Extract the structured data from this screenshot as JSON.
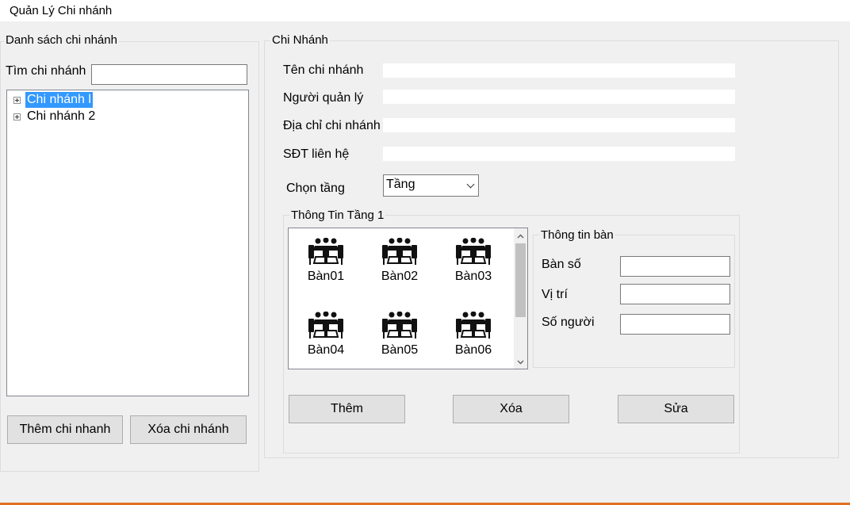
{
  "window": {
    "title": "Quản Lý Chi nhánh"
  },
  "left_panel": {
    "group_title": "Danh sách chi nhánh",
    "search_label": "Tìm chi nhánh",
    "search_value": "",
    "tree_items": [
      {
        "label": "Chi nhánh l",
        "selected": true
      },
      {
        "label": "Chi nhánh 2",
        "selected": false
      }
    ],
    "add_button": "Thêm chi nhanh",
    "delete_button": "Xóa chi nhánh"
  },
  "branch_panel": {
    "group_title": "Chi Nhánh",
    "name_label": "Tên chi nhánh",
    "manager_label": "Người quản lý",
    "address_label": "Địa chỉ chi nhánh",
    "phone_label": "SĐT liên hệ",
    "floor_label": "Chọn tầng",
    "floor_selected": "Tầng",
    "floor_group_title": "Thông Tin Tầng 1",
    "tables": [
      "Bàn01",
      "Bàn02",
      "Bàn03",
      "Bàn04",
      "Bàn05",
      "Bàn06"
    ],
    "table_info": {
      "group_title": "Thông tin bàn",
      "number_label": "Bàn số",
      "position_label": "Vị trí",
      "people_label": "Số người"
    },
    "add_button": "Thêm",
    "delete_button": "Xóa",
    "edit_button": "Sửa"
  },
  "icons": [
    "meeting-table-icon",
    "expand-plus-icon",
    "chevron-down-icon",
    "scroll-up-icon",
    "scroll-down-icon"
  ],
  "colors": {
    "selection": "#3399ff",
    "background": "#f0f0f0",
    "taskbar_accent": "#e07020"
  }
}
